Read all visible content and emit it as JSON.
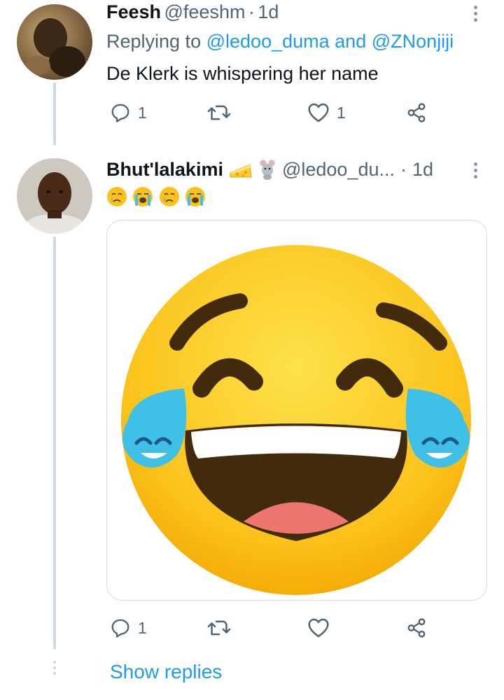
{
  "tweet1": {
    "display_name": "Feesh",
    "handle": "@feeshm",
    "separator": "·",
    "time": "1d",
    "replying_prefix": "Replying to",
    "replying_user1": "@ledoo_duma",
    "replying_and": "and",
    "replying_user2": "@ZNonjiji",
    "text": "De Klerk is whispering her name",
    "reply_count": "1",
    "like_count": "1"
  },
  "tweet2": {
    "display_name": "Bhut'lalakimi",
    "name_emojis": [
      "cheese-icon",
      "mouse-icon"
    ],
    "handle": "@ledoo_du...",
    "separator": "·",
    "time": "1d",
    "text_emojis": [
      "crying-face",
      "loudly-crying-face",
      "crying-face",
      "loudly-crying-face"
    ],
    "media_emoji": "face-with-tears-of-joy",
    "reply_count": "1"
  },
  "show_replies": "Show replies",
  "colors": {
    "accent": "#1d9bf0",
    "muted": "#536471",
    "thread_line": "#cfd9de",
    "emoji_yellow": "#fcc21b",
    "tear_blue": "#40c0e7"
  }
}
